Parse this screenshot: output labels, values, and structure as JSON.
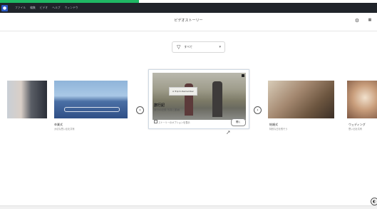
{
  "menubar": {
    "items": [
      "ファイル",
      "編集",
      "ビデオ",
      "ヘルプ",
      "ウィンドウ"
    ]
  },
  "header": {
    "title": "ビデオストーリー"
  },
  "filter": {
    "label": "すべて"
  },
  "carousel": {
    "left_card": {
      "title": "卒業式",
      "subtitle": "大切な思い出を共有"
    },
    "featured": {
      "title": "旅行記",
      "subtitle": "旅行の記録 写真と動画",
      "banner_text": "A Trip to Remember",
      "footer": "ストーリーのオプションを表示",
      "open_label": "開く"
    },
    "right_card": {
      "title": "結婚式",
      "subtitle": "特別な日を残そう"
    },
    "right_partial": {
      "title": "ウェディング",
      "subtitle": "思い出を共有"
    }
  },
  "colors": {
    "accent": "#1fb864",
    "menubar_bg": "#20242a"
  }
}
